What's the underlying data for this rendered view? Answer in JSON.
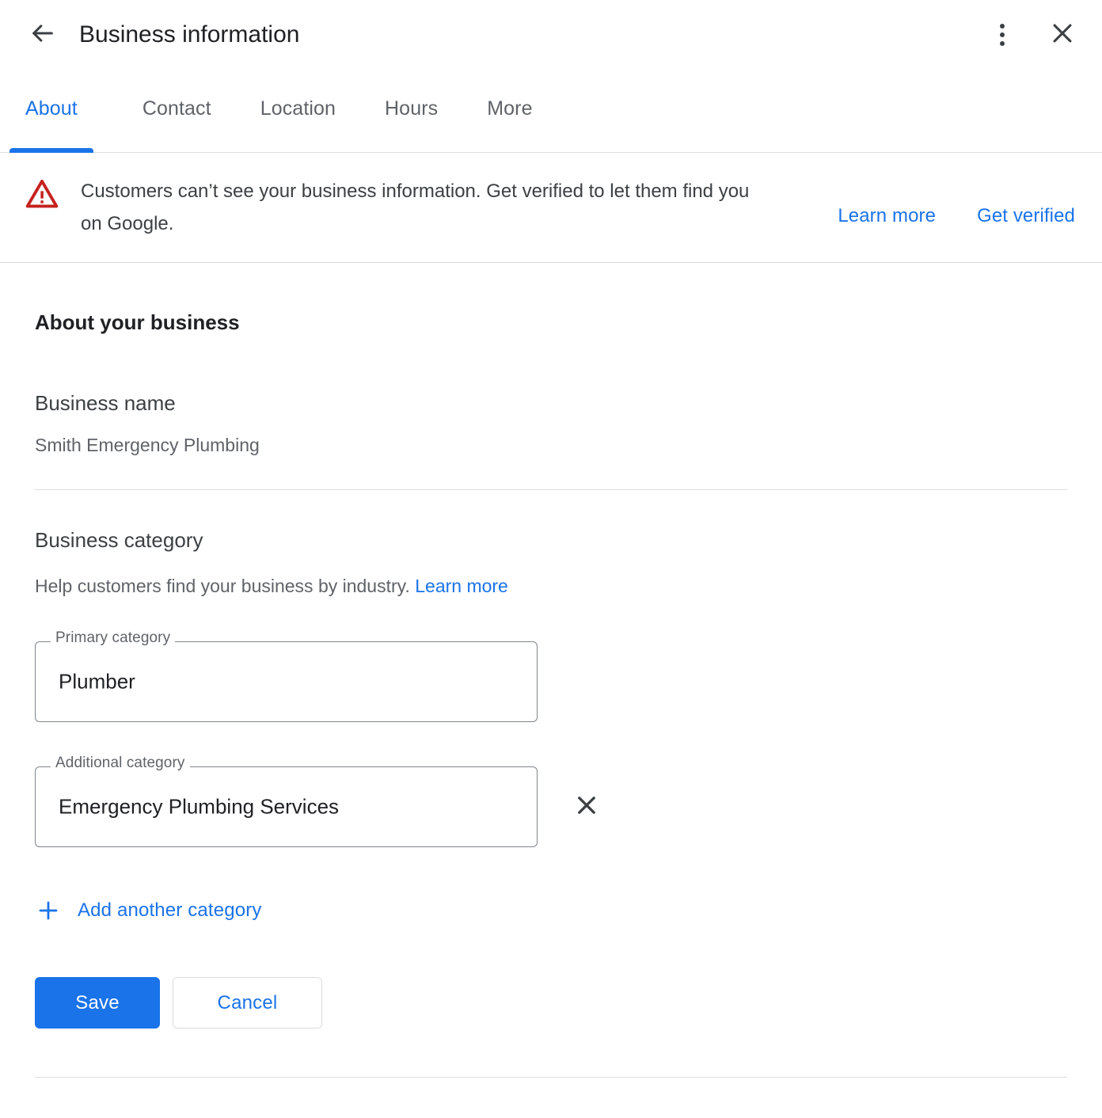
{
  "header": {
    "title": "Business information",
    "back_icon": "arrow-back-icon",
    "more_icon": "more-vert-icon",
    "close_icon": "close-icon"
  },
  "tabs": [
    {
      "label": "About",
      "active": true
    },
    {
      "label": "Contact",
      "active": false
    },
    {
      "label": "Location",
      "active": false
    },
    {
      "label": "Hours",
      "active": false
    },
    {
      "label": "More",
      "active": false
    }
  ],
  "banner": {
    "icon": "warning-triangle-icon",
    "message": "Customers can’t see your business information. Get verified to let them find you on Google.",
    "learn_more": "Learn more",
    "get_verified": "Get verified"
  },
  "about": {
    "section_title": "About your business",
    "business_name_label": "Business name",
    "business_name_value": "Smith Emergency Plumbing",
    "category_title": "Business category",
    "category_help": "Help customers find your business by industry.",
    "category_help_link": "Learn more",
    "primary_category": {
      "label": "Primary category",
      "value": "Plumber"
    },
    "additional_category": {
      "label": "Additional category",
      "value": "Emergency Plumbing Services",
      "clear_icon": "close-icon"
    },
    "add_category": {
      "icon": "plus-icon",
      "label": "Add another category"
    }
  },
  "actions": {
    "save": "Save",
    "cancel": "Cancel"
  },
  "colors": {
    "accent": "#1a73e8",
    "warning": "#c5221f",
    "text_primary": "#202124",
    "text_secondary": "#5f6368",
    "border": "#dadce0",
    "field_border": "#80868b"
  }
}
